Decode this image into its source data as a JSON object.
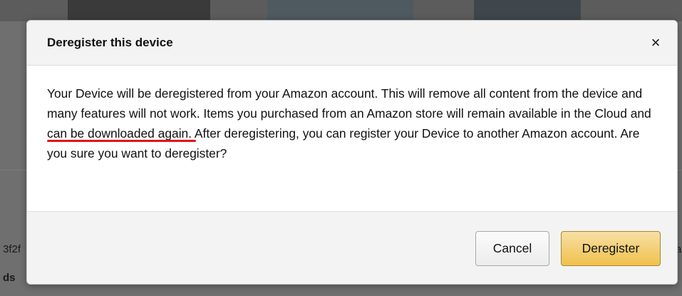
{
  "background": {
    "fragment_left_1": "3f2f",
    "fragment_left_2": "ds",
    "fragment_right_1": "a"
  },
  "dialog": {
    "title": "Deregister this device",
    "close_symbol": "×",
    "body_before": "Your Device will be deregistered from your Amazon account. This will remove all content from the device and many features will not work. Items you purchased from an Amazon store will remain available in the Cloud and ",
    "body_highlight": "can be downloaded again.",
    "body_after": " After deregistering, you can register your Device to another Amazon account. Are you sure you want to deregister?",
    "highlight_color": "#e3131a"
  },
  "footer": {
    "cancel_label": "Cancel",
    "deregister_label": "Deregister",
    "primary_color": "#f0c14b"
  }
}
